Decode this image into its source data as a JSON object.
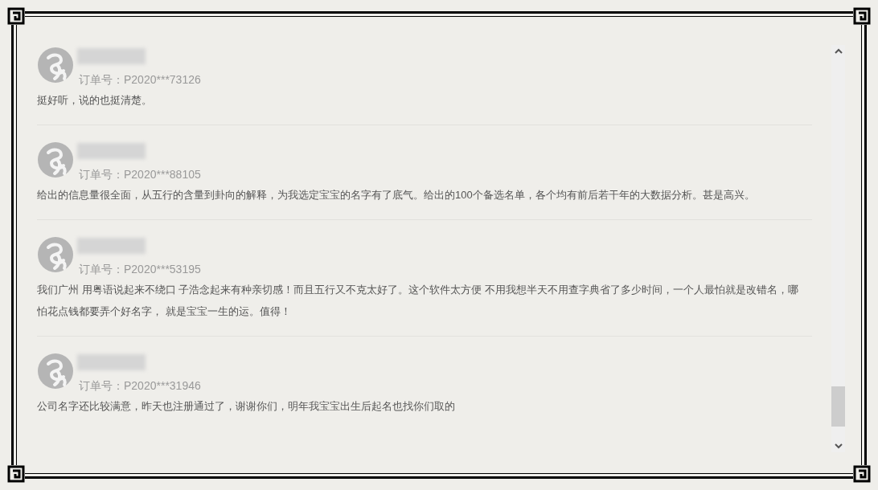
{
  "reviews": [
    {
      "order": "订单号：P2020***73126",
      "text": "挺好听，说的也挺清楚。"
    },
    {
      "order": "订单号：P2020***88105",
      "text": "给出的信息量很全面，从五行的含量到卦向的解释，为我选定宝宝的名字有了底气。给出的100个备选名单，各个均有前后若干年的大数据分析。甚是高兴。"
    },
    {
      "order": "订单号：P2020***53195",
      "text": "我们广州 用粤语说起来不绕口 子浩念起来有种亲切感！而且五行又不克太好了。这个软件太方便 不用我想半天不用查字典省了多少时间，一个人最怕就是改错名，哪怕花点钱都要弄个好名字， 就是宝宝一生的运。值得！"
    },
    {
      "order": "订单号：P2020***31946",
      "text": "公司名字还比较满意，昨天也注册通过了，谢谢你们，明年我宝宝出生后起名也找你们取的"
    }
  ]
}
